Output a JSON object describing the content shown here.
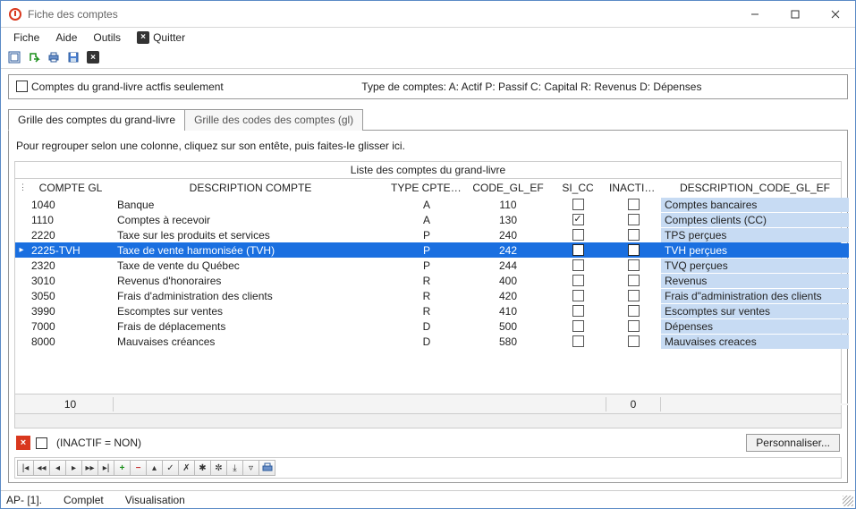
{
  "window": {
    "title": "Fiche des comptes"
  },
  "menu": {
    "fiche": "Fiche",
    "aide": "Aide",
    "outils": "Outils",
    "quitter": "Quitter"
  },
  "options": {
    "activeOnly": "Comptes du grand-livre actfis seulement",
    "typeLegend": "Type de comptes:  A: Actif P: Passif C: Capital R: Revenus D: Dépenses"
  },
  "tabs": {
    "grid": "Grille des comptes du grand-livre",
    "codes": "Grille des codes des comptes (gl)"
  },
  "grid": {
    "groupHint": "Pour regrouper selon une colonne, cliquez sur son entête, puis faites-le glisser ici.",
    "title": "Liste des comptes du grand-livre",
    "headers": {
      "compte": "COMPTE GL",
      "desc": "DESCRIPTION COMPTE",
      "type": "TYPE CPTE EF",
      "code": "CODE_GL_EF",
      "sicc": "SI_CC",
      "inactif": "INACTIF",
      "desccode": "DESCRIPTION_CODE_GL_EF"
    },
    "rows": [
      {
        "compte": "1040",
        "desc": "Banque",
        "type": "A",
        "code": "110",
        "sicc": false,
        "inactif": false,
        "desccode": "Comptes bancaires",
        "sel": false
      },
      {
        "compte": "1110",
        "desc": "Comptes à recevoir",
        "type": "A",
        "code": "130",
        "sicc": true,
        "inactif": false,
        "desccode": "Comptes clients (CC)",
        "sel": false
      },
      {
        "compte": "2220",
        "desc": "Taxe sur les produits et services",
        "type": "P",
        "code": "240",
        "sicc": false,
        "inactif": false,
        "desccode": "TPS perçues",
        "sel": false
      },
      {
        "compte": "2225-TVH",
        "desc": "Taxe de vente harmonisée (TVH)",
        "type": "P",
        "code": "242",
        "sicc": false,
        "inactif": false,
        "desccode": "TVH perçues",
        "sel": true
      },
      {
        "compte": "2320",
        "desc": "Taxe de vente du Québec",
        "type": "P",
        "code": "244",
        "sicc": false,
        "inactif": false,
        "desccode": "TVQ perçues",
        "sel": false
      },
      {
        "compte": "3010",
        "desc": "Revenus d'honoraires",
        "type": "R",
        "code": "400",
        "sicc": false,
        "inactif": false,
        "desccode": "Revenus",
        "sel": false
      },
      {
        "compte": "3050",
        "desc": "Frais d'administration des clients",
        "type": "R",
        "code": "420",
        "sicc": false,
        "inactif": false,
        "desccode": "Frais d\"administration des clients",
        "sel": false
      },
      {
        "compte": "3990",
        "desc": "Escomptes sur ventes",
        "type": "R",
        "code": "410",
        "sicc": false,
        "inactif": false,
        "desccode": "Escomptes sur ventes",
        "sel": false
      },
      {
        "compte": "7000",
        "desc": "Frais de déplacements",
        "type": "D",
        "code": "500",
        "sicc": false,
        "inactif": false,
        "desccode": "Dépenses",
        "sel": false
      },
      {
        "compte": "8000",
        "desc": "Mauvaises créances",
        "type": "D",
        "code": "580",
        "sicc": false,
        "inactif": false,
        "desccode": "Mauvaises creaces",
        "sel": false
      }
    ],
    "footer": {
      "count": "10",
      "inactive": "0"
    }
  },
  "filter": {
    "text": "(INACTIF = NON)",
    "personalize": "Personnaliser..."
  },
  "status": {
    "left": "AP- [1].",
    "mid": "Complet",
    "right": "Visualisation"
  }
}
